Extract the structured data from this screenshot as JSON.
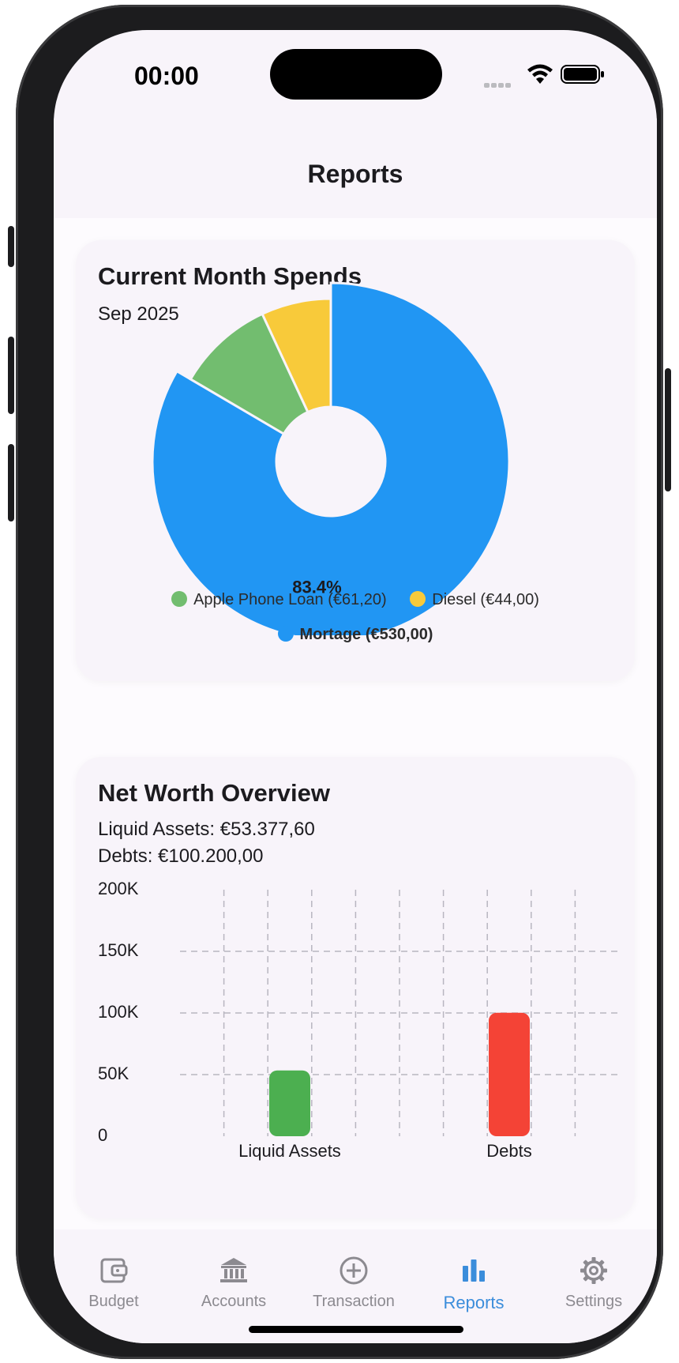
{
  "status_bar": {
    "time": "00:00"
  },
  "header": {
    "title": "Reports"
  },
  "spends_card": {
    "title": "Current Month Spends",
    "subtitle": "Sep 2025",
    "chart_data": {
      "type": "pie",
      "title": "Current Month Spends",
      "subtitle": "Sep 2025",
      "donut": true,
      "slices": [
        {
          "label": "Mortage",
          "amount_label": "€530,00",
          "value": 530.0,
          "percent_label": "83.4%",
          "color": "#2196f3",
          "selected": true
        },
        {
          "label": "Apple Phone Loan",
          "amount_label": "€61,20",
          "value": 61.2,
          "color": "#72bd6f"
        },
        {
          "label": "Diesel",
          "amount_label": "€44,00",
          "value": 44.0,
          "color": "#f8ca3a"
        }
      ],
      "legend": {
        "placement": "bottom",
        "items": [
          {
            "text": "Apple Phone Loan (€61,20)",
            "color": "#72bd6f"
          },
          {
            "text": "Diesel (€44,00)",
            "color": "#f8ca3a"
          },
          {
            "text": "Mortage (€530,00)",
            "color": "#2196f3",
            "bold": true
          }
        ]
      }
    }
  },
  "networth_card": {
    "title": "Net Worth Overview",
    "liquid_assets_text": "Liquid Assets: €53.377,60",
    "debts_text": "Debts: €100.200,00",
    "chart_data": {
      "type": "bar",
      "categories": [
        "Liquid Assets",
        "Debts"
      ],
      "values": [
        53377.6,
        100200.0
      ],
      "colors": [
        "#4caf50",
        "#f44336"
      ],
      "ylim": [
        0,
        200000
      ],
      "yticks": [
        0,
        50000,
        100000,
        150000,
        200000
      ],
      "ytick_labels": [
        "0",
        "50K",
        "100K",
        "150K",
        "200K"
      ],
      "grid": true,
      "grid_style": "dashed"
    }
  },
  "tab_bar": {
    "items": [
      {
        "label": "Budget",
        "icon": "wallet-icon",
        "active": false
      },
      {
        "label": "Accounts",
        "icon": "bank-icon",
        "active": false
      },
      {
        "label": "Transaction",
        "icon": "plus-circle-icon",
        "active": false
      },
      {
        "label": "Reports",
        "icon": "bar-chart-icon",
        "active": true
      },
      {
        "label": "Settings",
        "icon": "gear-icon",
        "active": false
      }
    ],
    "colors": {
      "active": "#3b8ddb",
      "inactive": "#8c8a90"
    }
  }
}
